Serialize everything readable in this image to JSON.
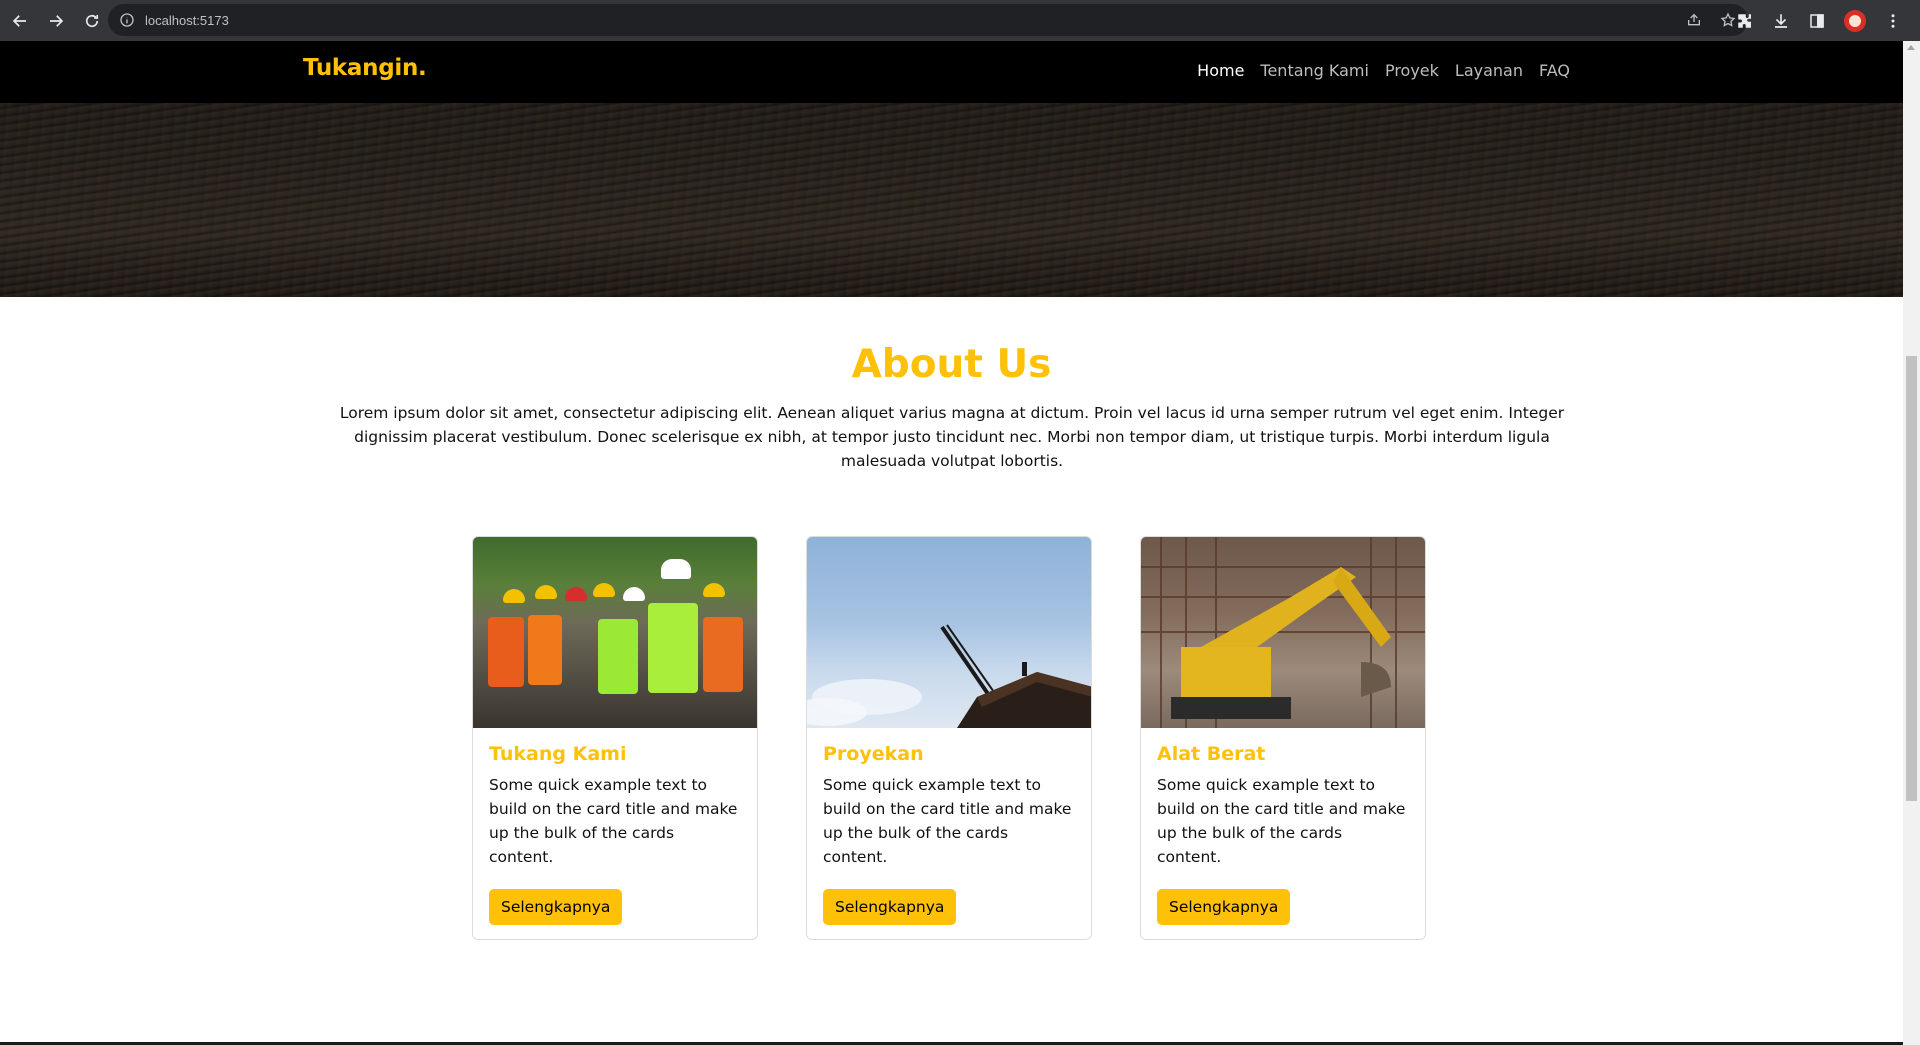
{
  "browser": {
    "url": "localhost:5173"
  },
  "navbar": {
    "brand": "Tukangin.",
    "items": [
      {
        "label": "Home",
        "active": true
      },
      {
        "label": "Tentang Kami",
        "active": false
      },
      {
        "label": "Proyek",
        "active": false
      },
      {
        "label": "Layanan",
        "active": false
      },
      {
        "label": "FAQ",
        "active": false
      }
    ]
  },
  "about": {
    "title": "About Us",
    "text": "Lorem ipsum dolor sit amet, consectetur adipiscing elit. Aenean aliquet varius magna at dictum. Proin vel lacus id urna semper rutrum vel eget enim. Integer dignissim placerat vestibulum. Donec scelerisque ex nibh, at tempor justo tincidunt nec. Morbi non tempor diam, ut tristique turpis. Morbi interdum ligula malesuada volutpat lobortis."
  },
  "cards": [
    {
      "title": "Tukang Kami",
      "text": "Some quick example text to build on the card title and make up the bulk of the cards content.",
      "button": "Selengkapnya",
      "image": "construction-workers-photo"
    },
    {
      "title": "Proyekan",
      "text": "Some quick example text to build on the card title and make up the bulk of the cards content.",
      "button": "Selengkapnya",
      "image": "crane-sky-photo"
    },
    {
      "title": "Alat Berat",
      "text": "Some quick example text to build on the card title and make up the bulk of the cards content.",
      "button": "Selengkapnya",
      "image": "excavator-photo"
    }
  ],
  "colors": {
    "accent": "#ffc107",
    "navbar": "#000000",
    "chrome": "#35363a"
  }
}
